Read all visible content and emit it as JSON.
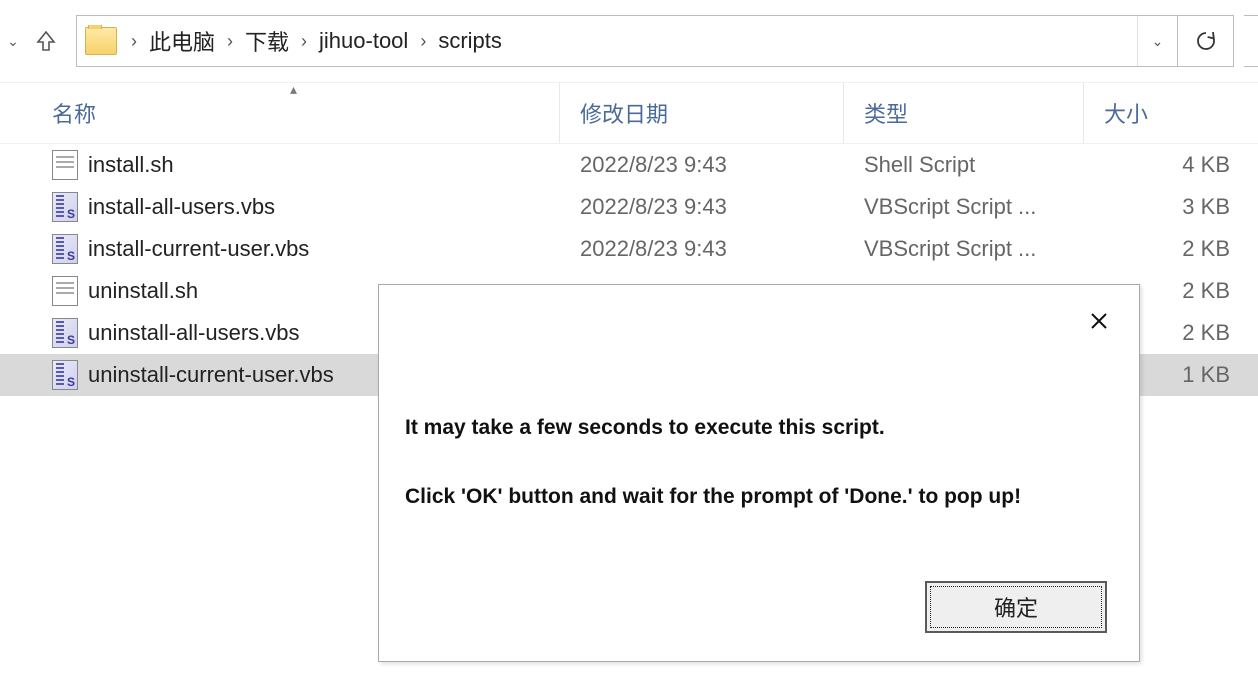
{
  "toolbar": {
    "breadcrumbs": [
      "此电脑",
      "下载",
      "jihuo-tool",
      "scripts"
    ]
  },
  "columns": {
    "name": "名称",
    "date": "修改日期",
    "type": "类型",
    "size": "大小"
  },
  "files": [
    {
      "name": "install.sh",
      "date": "2022/8/23 9:43",
      "type": "Shell Script",
      "size": "4 KB",
      "icon": "sh",
      "selected": false
    },
    {
      "name": "install-all-users.vbs",
      "date": "2022/8/23 9:43",
      "type": "VBScript Script ...",
      "size": "3 KB",
      "icon": "vbs",
      "selected": false
    },
    {
      "name": "install-current-user.vbs",
      "date": "2022/8/23 9:43",
      "type": "VBScript Script ...",
      "size": "2 KB",
      "icon": "vbs",
      "selected": false
    },
    {
      "name": "uninstall.sh",
      "date": "",
      "type": "",
      "size": "2 KB",
      "icon": "sh",
      "selected": false
    },
    {
      "name": "uninstall-all-users.vbs",
      "date": "",
      "type": "",
      "size": "2 KB",
      "icon": "vbs",
      "selected": false
    },
    {
      "name": "uninstall-current-user.vbs",
      "date": "",
      "type": "",
      "size": "1 KB",
      "icon": "vbs",
      "selected": true
    }
  ],
  "dialog": {
    "line1": "It may take a few seconds to execute this script.",
    "line2": "Click 'OK' button and wait for the prompt of 'Done.' to pop up!",
    "ok_label": "确定"
  }
}
